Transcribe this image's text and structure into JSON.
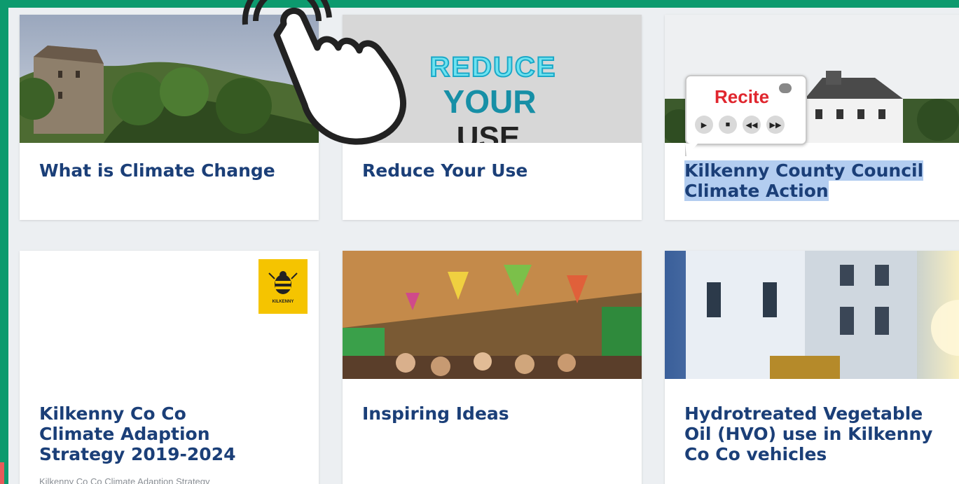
{
  "cards": [
    {
      "title": "What is Climate Change"
    },
    {
      "title": "Reduce Your Use",
      "image_text": [
        "REDUCE",
        "YOUR",
        "USE"
      ]
    },
    {
      "title": "Kilkenny County Council Climate Action"
    },
    {
      "title": "Kilkenny Co Co Climate Adaption Strategy 2019-2024",
      "excerpt": "Kilkenny Co Co Climate Adaption Strategy",
      "logo_text": "KILKENNY"
    },
    {
      "title": "Inspiring Ideas"
    },
    {
      "title": "Hydrotreated Vegetable Oil (HVO) use in Kilkenny Co Co vehicles"
    }
  ],
  "recite": {
    "logo": "Recite",
    "controls": [
      "play-icon",
      "stop-icon",
      "rewind-icon",
      "fast-forward-icon"
    ]
  },
  "colors": {
    "border": "#0d9a6e",
    "title": "#1b3f78",
    "highlight": "#b3cdf0",
    "recite_red": "#e0262e"
  }
}
